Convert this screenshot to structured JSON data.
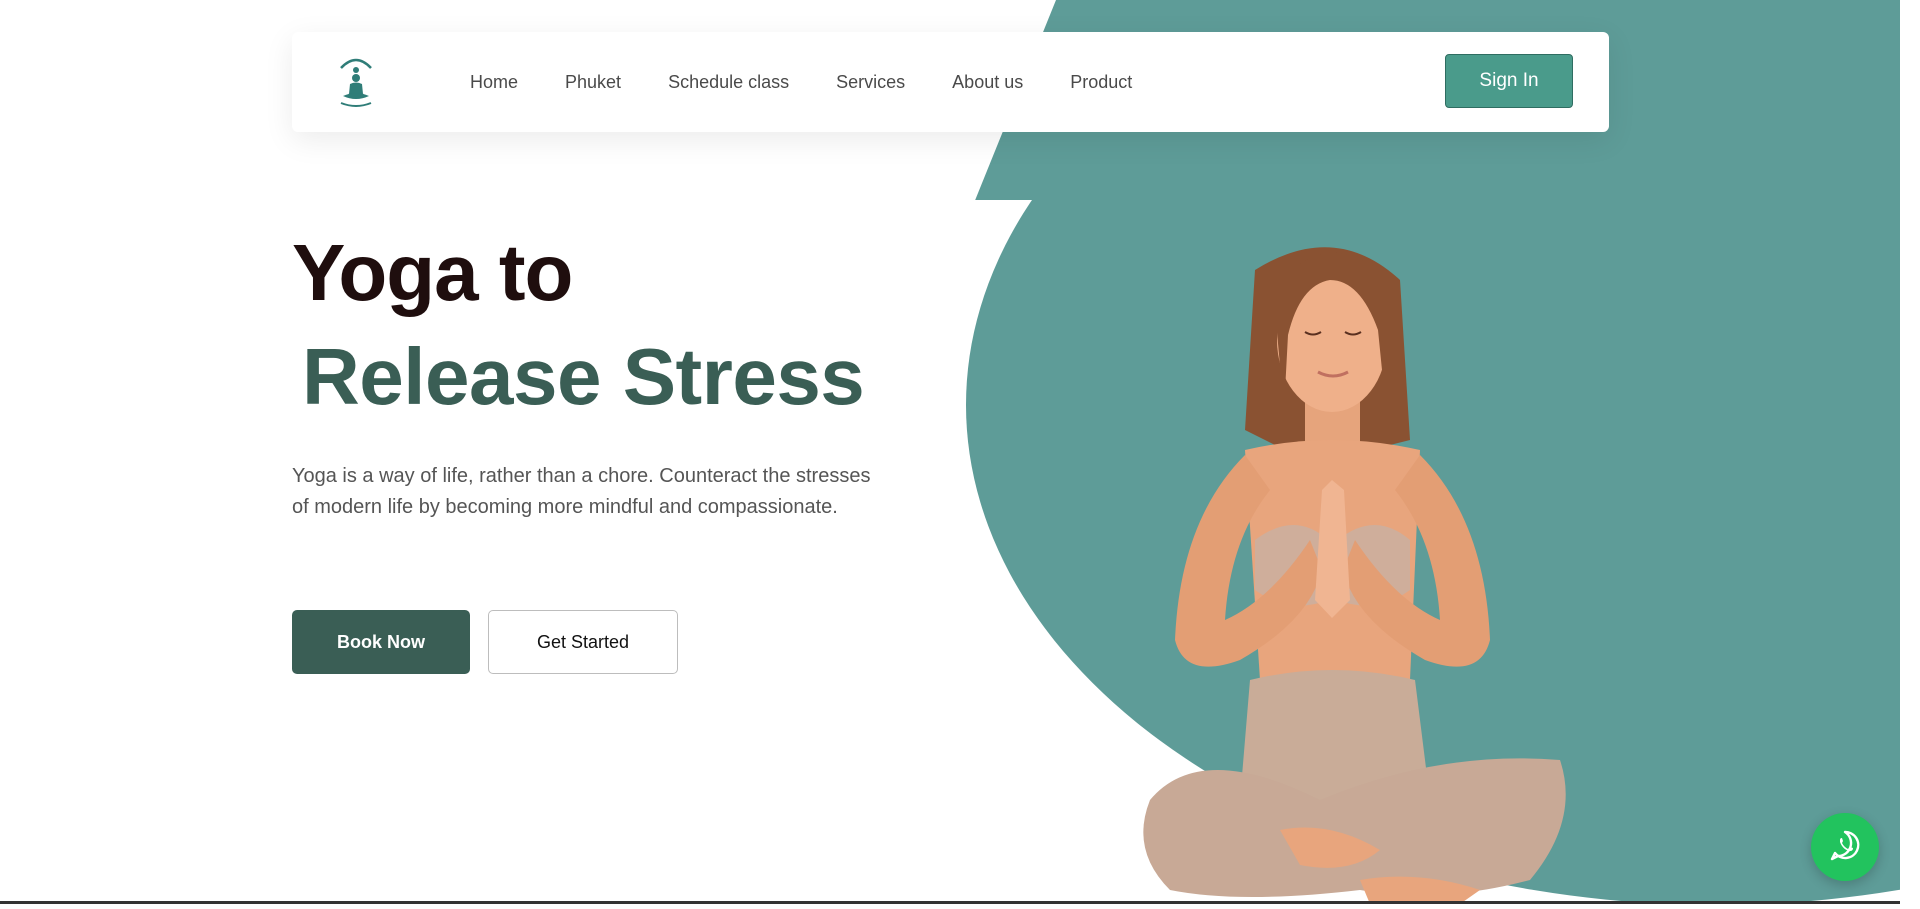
{
  "nav": {
    "logo_name": "yoga-logo",
    "links": [
      {
        "label": "Home"
      },
      {
        "label": "Phuket"
      },
      {
        "label": "Schedule class"
      },
      {
        "label": "Services"
      },
      {
        "label": "About us"
      },
      {
        "label": "Product"
      }
    ],
    "signin_label": "Sign In"
  },
  "hero": {
    "title_line1": "Yoga to",
    "title_line2": "Release Stress",
    "description": "Yoga is a way of life, rather than a chore. Counteract the stresses of modern life by becoming more mindful and compassionate.",
    "book_label": "Book Now",
    "start_label": "Get Started"
  },
  "floating": {
    "icon": "whatsapp-icon"
  },
  "colors": {
    "accent_teal": "#5e9c98",
    "signin_green": "#4a9b8b",
    "dark_green": "#3a5e55",
    "title_dark": "#1f0e0e",
    "whatsapp": "#22c35e"
  }
}
